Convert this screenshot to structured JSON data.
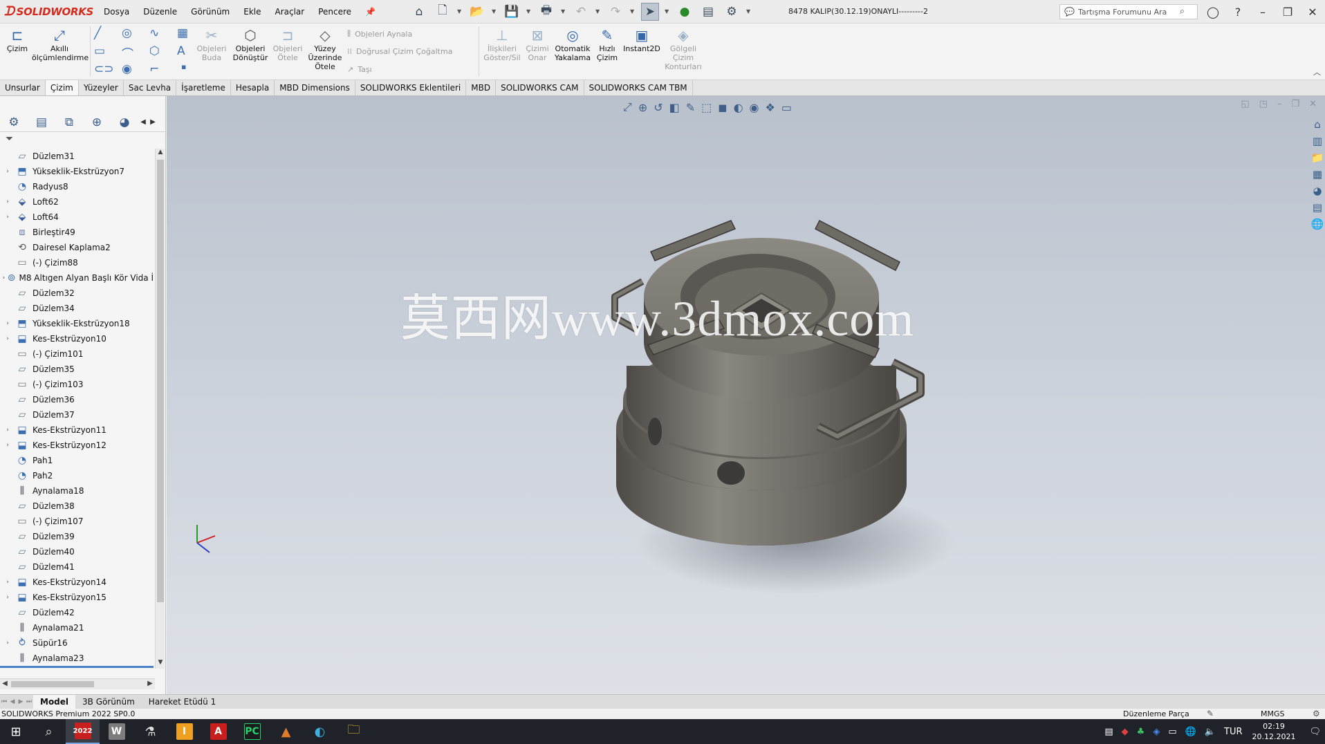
{
  "app": {
    "brand": "SOLIDWORKS",
    "document_title": "8478 KALIP(30.12.19)ONAYLI---------2",
    "menu": [
      "Dosya",
      "Düzenle",
      "Görünüm",
      "Ekle",
      "Araçlar",
      "Pencere"
    ],
    "search_placeholder": "Tartışma Forumunu Ara"
  },
  "ribbon": {
    "cizim": "Çizim",
    "akilli_1": "Akıllı",
    "akilli_2": "ölçümlendirme",
    "budama_1": "Objeleri",
    "budama_2": "Buda",
    "donustur_1": "Objeleri",
    "donustur_2": "Dönüştür",
    "otele_1": "Objeleri",
    "otele_2": "Ötele",
    "yuzey_1": "Yüzey",
    "yuzey_2": "Üzerinde",
    "yuzey_3": "Ötele",
    "aynala": "Objeleri Aynala",
    "dogrusal": "Doğrusal Çizim Çoğaltma",
    "tasi": "Taşı",
    "iliski_1": "İlişkileri",
    "iliski_2": "Göster/Sil",
    "onar_1": "Çizimi",
    "onar_2": "Onar",
    "yakala_1": "Otomatik",
    "yakala_2": "Yakalama",
    "hizli_1": "Hızlı",
    "hizli_2": "Çizim",
    "instant": "Instant2D",
    "golgeli_1": "Gölgeli",
    "golgeli_2": "Çizim",
    "golgeli_3": "Konturları"
  },
  "tabs": [
    "Unsurlar",
    "Çizim",
    "Yüzeyler",
    "Sac Levha",
    "İşaretleme",
    "Hesapla",
    "MBD Dimensions",
    "SOLIDWORKS Eklentileri",
    "MBD",
    "SOLIDWORKS CAM",
    "SOLIDWORKS CAM TBM"
  ],
  "active_tab": "Çizim",
  "tree": [
    {
      "label": "Düzlem31",
      "icon": "plane",
      "expandable": false
    },
    {
      "label": "Yükseklik-Ekstrüzyon7",
      "icon": "extrude",
      "expandable": true
    },
    {
      "label": "Radyus8",
      "icon": "fillet",
      "expandable": false
    },
    {
      "label": "Loft62",
      "icon": "loft",
      "expandable": true
    },
    {
      "label": "Loft64",
      "icon": "loft",
      "expandable": true
    },
    {
      "label": "Birleştir49",
      "icon": "combine",
      "expandable": false
    },
    {
      "label": "Dairesel Kaplama2",
      "icon": "pattern",
      "expandable": false
    },
    {
      "label": "(-) Çizim88",
      "icon": "sketch",
      "expandable": false
    },
    {
      "label": "M8 Altıgen Alyan Başlı Kör Vida İ",
      "icon": "hole",
      "expandable": true
    },
    {
      "label": "Düzlem32",
      "icon": "plane",
      "expandable": false
    },
    {
      "label": "Düzlem34",
      "icon": "plane",
      "expandable": false
    },
    {
      "label": "Yükseklik-Ekstrüzyon18",
      "icon": "extrude",
      "expandable": true
    },
    {
      "label": "Kes-Ekstrüzyon10",
      "icon": "cut",
      "expandable": true
    },
    {
      "label": "(-) Çizim101",
      "icon": "sketch",
      "expandable": false
    },
    {
      "label": "Düzlem35",
      "icon": "plane",
      "expandable": false
    },
    {
      "label": "(-) Çizim103",
      "icon": "sketch",
      "expandable": false
    },
    {
      "label": "Düzlem36",
      "icon": "plane",
      "expandable": false
    },
    {
      "label": "Düzlem37",
      "icon": "plane",
      "expandable": false
    },
    {
      "label": "Kes-Ekstrüzyon11",
      "icon": "cut",
      "expandable": true
    },
    {
      "label": "Kes-Ekstrüzyon12",
      "icon": "cut",
      "expandable": true
    },
    {
      "label": "Pah1",
      "icon": "fillet",
      "expandable": false
    },
    {
      "label": "Pah2",
      "icon": "fillet",
      "expandable": false
    },
    {
      "label": "Aynalama18",
      "icon": "mirror",
      "expandable": false
    },
    {
      "label": "Düzlem38",
      "icon": "plane",
      "expandable": false
    },
    {
      "label": "(-) Çizim107",
      "icon": "sketch",
      "expandable": false
    },
    {
      "label": "Düzlem39",
      "icon": "plane",
      "expandable": false
    },
    {
      "label": "Düzlem40",
      "icon": "plane",
      "expandable": false
    },
    {
      "label": "Düzlem41",
      "icon": "plane",
      "expandable": false
    },
    {
      "label": "Kes-Ekstrüzyon14",
      "icon": "cut",
      "expandable": true
    },
    {
      "label": "Kes-Ekstrüzyon15",
      "icon": "cut",
      "expandable": true
    },
    {
      "label": "Düzlem42",
      "icon": "plane",
      "expandable": false
    },
    {
      "label": "Aynalama21",
      "icon": "mirror",
      "expandable": false
    },
    {
      "label": "Süpür16",
      "icon": "sweep",
      "expandable": true
    },
    {
      "label": "Aynalama23",
      "icon": "mirror",
      "expandable": false
    }
  ],
  "viewport": {
    "watermark": "莫西网www.3dmox.com"
  },
  "model_tabs": [
    "Model",
    "3B Görünüm",
    "Hareket Etüdü 1"
  ],
  "active_model_tab": "Model",
  "status": {
    "left": "SOLIDWORKS Premium 2022 SP0.0",
    "mode": "Düzenleme Parça",
    "units": "MMGS"
  },
  "taskbar": {
    "lang": "TUR",
    "time": "02:19",
    "date": "20.12.2021",
    "sw_year": "2022"
  },
  "colors": {
    "brand_red": "#d52b1e",
    "part_gray": "#7a7670",
    "accent_blue": "#3d6fb0"
  }
}
